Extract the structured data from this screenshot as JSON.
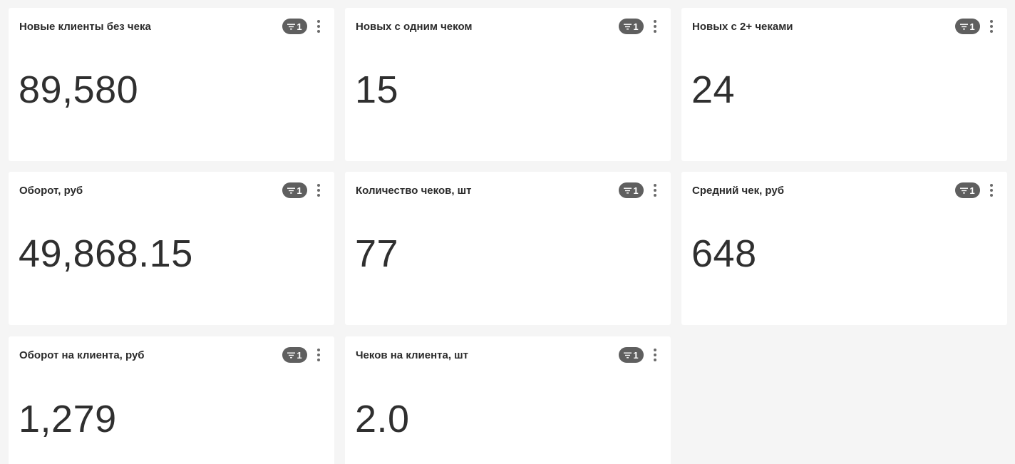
{
  "cards": [
    {
      "title": "Новые клиенты без чека",
      "value": "89,580",
      "filter_count": "1"
    },
    {
      "title": "Новых с одним чеком",
      "value": "15",
      "filter_count": "1"
    },
    {
      "title": "Новых с 2+ чеками",
      "value": "24",
      "filter_count": "1"
    },
    {
      "title": "Оборот, руб",
      "value": "49,868.15",
      "filter_count": "1"
    },
    {
      "title": "Количество чеков, шт",
      "value": "77",
      "filter_count": "1"
    },
    {
      "title": "Средний чек, руб",
      "value": "648",
      "filter_count": "1"
    },
    {
      "title": "Оборот на клиента, руб",
      "value": "1,279",
      "filter_count": "1"
    },
    {
      "title": "Чеков на клиента, шт",
      "value": "2.0",
      "filter_count": "1"
    }
  ],
  "icons": {
    "filter": "filter-icon",
    "menu": "kebab-menu-icon"
  },
  "colors": {
    "background": "#f5f5f5",
    "card": "#ffffff",
    "badge": "#5f5f5f",
    "text": "#2f2f2f"
  }
}
